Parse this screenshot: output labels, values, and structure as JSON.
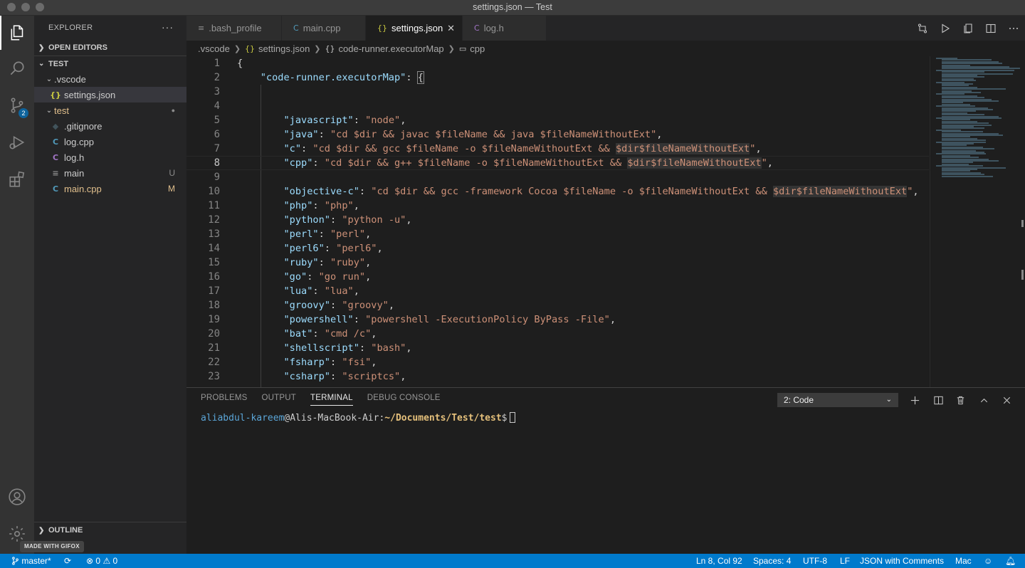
{
  "window": {
    "title": "settings.json — Test"
  },
  "activity_bar": {
    "items": [
      {
        "name": "explorer-icon",
        "active": true
      },
      {
        "name": "search-icon"
      },
      {
        "name": "source-control-icon",
        "badge": "2"
      },
      {
        "name": "run-debug-icon"
      },
      {
        "name": "extensions-icon"
      }
    ],
    "bottom": [
      "accounts-icon",
      "manage-gear-icon"
    ]
  },
  "sidebar": {
    "title": "EXPLORER",
    "more": "···",
    "open_editors": "OPEN EDITORS",
    "workspace": "TEST",
    "outline": "OUTLINE",
    "tree": [
      {
        "label": ".vscode",
        "type": "folder",
        "depth": 1,
        "expanded": true
      },
      {
        "label": "settings.json",
        "type": "json",
        "depth": 2,
        "selected": true,
        "icon": "{}"
      },
      {
        "label": "test",
        "type": "folder",
        "depth": 1,
        "expanded": true,
        "deco": "●"
      },
      {
        "label": ".gitignore",
        "type": "file",
        "depth": 2,
        "icon": "◆"
      },
      {
        "label": "log.cpp",
        "type": "cpp",
        "depth": 2,
        "icon": "C"
      },
      {
        "label": "log.h",
        "type": "h",
        "depth": 2,
        "icon": "C"
      },
      {
        "label": "main",
        "type": "file",
        "depth": 2,
        "icon": "≡",
        "deco": "U",
        "status": "untracked"
      },
      {
        "label": "main.cpp",
        "type": "cpp",
        "depth": 2,
        "icon": "C",
        "deco": "M",
        "status": "modified"
      }
    ]
  },
  "tabs": [
    {
      "label": ".bash_profile",
      "icon": "≡"
    },
    {
      "label": "main.cpp",
      "icon": "C"
    },
    {
      "label": "settings.json",
      "icon": "{}",
      "active": true,
      "close": "✕"
    },
    {
      "label": "log.h",
      "icon": "C"
    }
  ],
  "breadcrumb": {
    "items": [
      ".vscode",
      "settings.json",
      "code-runner.executorMap",
      "cpp"
    ],
    "icons": [
      "",
      "{}",
      "{}",
      "▭"
    ]
  },
  "editor": {
    "current_line": 8,
    "lines": [
      {
        "n": "1",
        "text": "{"
      },
      {
        "n": "2",
        "key": "code-runner.executorMap",
        "after": ": {"
      },
      {
        "n": "3",
        "text": ""
      },
      {
        "n": "4",
        "text": ""
      },
      {
        "n": "5",
        "key": "javascript",
        "value": "node"
      },
      {
        "n": "6",
        "key": "java",
        "value": "cd $dir && javac $fileName && java $fileNameWithoutExt"
      },
      {
        "n": "7",
        "key": "c",
        "value": "cd $dir && gcc $fileName -o $fileNameWithoutExt && $dir$fileNameWithoutExt"
      },
      {
        "n": "8",
        "key": "cpp",
        "value": "cd $dir && g++ $fileName -o $fileNameWithoutExt && $dir$fileNameWithoutExt"
      },
      {
        "n": "9",
        "text": ""
      },
      {
        "n": "10",
        "key": "objective-c",
        "value": "cd $dir && gcc -framework Cocoa $fileName -o $fileNameWithoutExt && $dir$fileNameWithoutExt"
      },
      {
        "n": "11",
        "key": "php",
        "value": "php"
      },
      {
        "n": "12",
        "key": "python",
        "value": "python -u"
      },
      {
        "n": "13",
        "key": "perl",
        "value": "perl"
      },
      {
        "n": "14",
        "key": "perl6",
        "value": "perl6"
      },
      {
        "n": "15",
        "key": "ruby",
        "value": "ruby"
      },
      {
        "n": "16",
        "key": "go",
        "value": "go run"
      },
      {
        "n": "17",
        "key": "lua",
        "value": "lua"
      },
      {
        "n": "18",
        "key": "groovy",
        "value": "groovy"
      },
      {
        "n": "19",
        "key": "powershell",
        "value": "powershell -ExecutionPolicy ByPass -File"
      },
      {
        "n": "20",
        "key": "bat",
        "value": "cmd /c"
      },
      {
        "n": "21",
        "key": "shellscript",
        "value": "bash"
      },
      {
        "n": "22",
        "key": "fsharp",
        "value": "fsi"
      },
      {
        "n": "23",
        "key": "csharp",
        "value": "scriptcs"
      }
    ]
  },
  "panel": {
    "tabs": [
      {
        "label": "PROBLEMS"
      },
      {
        "label": "OUTPUT"
      },
      {
        "label": "TERMINAL",
        "active": true
      },
      {
        "label": "DEBUG CONSOLE"
      }
    ],
    "terminal_select": "2: Code",
    "prompt": {
      "user": "aliabdul-kareem",
      "at": "@",
      "host": "Alis-MacBook-Air",
      "colon": ":",
      "path": "~/Documents/Test/test",
      "symbol": "$"
    }
  },
  "statusbar": {
    "branch": "master*",
    "errors": "0",
    "warnings": "0",
    "position": "Ln 8, Col 92",
    "spaces": "Spaces: 4",
    "encoding": "UTF-8",
    "eol": "LF",
    "language": "JSON with Comments",
    "platform": "Mac"
  },
  "watermark": "MADE WITH GIFOX"
}
